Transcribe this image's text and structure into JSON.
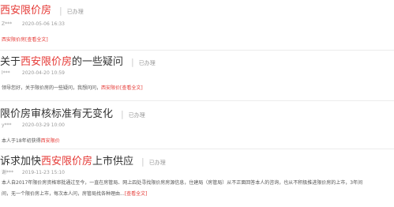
{
  "colors": {
    "accent": "#e53935",
    "text": "#333333",
    "muted": "#999999",
    "divider": "#ececec"
  },
  "posts": [
    {
      "title_pre": "",
      "title_hl": "西安限价房",
      "title_post": "",
      "status": "已办理",
      "user": "Z***",
      "date": "2020-05-06 16:33",
      "body_lines": [
        {
          "pre": "",
          "hl": "西安限价房",
          "post": "",
          "link": "[查看全文]"
        }
      ]
    },
    {
      "title_pre": "关于",
      "title_hl": "西安限价房",
      "title_post": "的一些疑问",
      "status": "已办理",
      "user": "l***",
      "date": "2020-04-20 10:59",
      "body_lines": [
        {
          "pre": "领导您好，关于限价房的一些疑问，我想问问，",
          "hl": "西安限价",
          "post": "",
          "link": "[查看全文]"
        }
      ]
    },
    {
      "title_pre": "限价房审核标准有无变化",
      "title_hl": "",
      "title_post": "",
      "status": "已办理",
      "user": "y***",
      "date": "2020-03-29 10:00",
      "body_lines": [
        {
          "pre": "本人于18年初获得",
          "hl": "西安限价",
          "post": "",
          "link": ""
        }
      ]
    },
    {
      "title_pre": "诉求加快",
      "title_hl": "西安限价房",
      "title_post": "上市供应",
      "status": "已办理",
      "user": "谢***",
      "date": "2019-11-23 15:10",
      "body_lines": [
        {
          "pre": "本人自2017年限价房资格审批通过至今，一直在房管局、网上四处寻找限价房房源信息，住建局（房管局）从不正面回答本人的咨询，也从不积极推进限价房的上市，3年间",
          "hl": "",
          "post": "",
          "link": ""
        },
        {
          "pre": "间，无一个限价房上市，每次本人问，房管局找各种理由...",
          "hl": "",
          "post": "",
          "link": "[查看全文]"
        }
      ]
    }
  ]
}
